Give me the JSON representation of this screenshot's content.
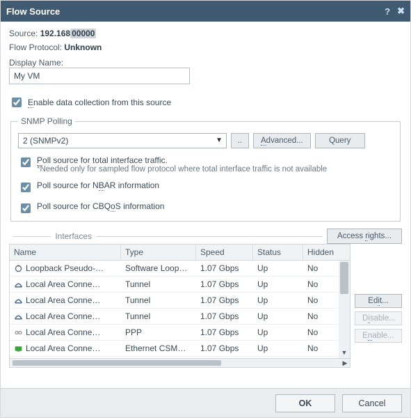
{
  "title": "Flow Source",
  "header": {
    "source_label": "Source:",
    "source_value": "192.168",
    "flow_protocol_label": "Flow Protocol:",
    "flow_protocol_value": "Unknown",
    "display_name_label": "Display Name:",
    "display_name_value": "My VM",
    "enable_label": "Enable data collection from this source"
  },
  "snmp": {
    "legend": "SNMP Polling",
    "version": "2 (SNMPv2)",
    "advanced_btn": "Advanced...",
    "query_btn": "Query",
    "poll_total_label": "Poll source for total interface traffic.",
    "poll_total_note": "*Needed only for sampled flow protocol where total interface traffic is not available",
    "poll_nbar_label": "Poll source for NBAR information",
    "poll_cbqos_label": "Poll source for CBQoS information"
  },
  "interfaces": {
    "title": "Interfaces",
    "access_btn": "Access rights...",
    "columns": {
      "name": "Name",
      "type": "Type",
      "speed": "Speed",
      "status": "Status",
      "hidden": "Hidden"
    },
    "rows": [
      {
        "icon": "loopback",
        "name": "Loopback Pseudo-…",
        "type": "Software Loop…",
        "speed": "1.07 Gbps",
        "status": "Up",
        "hidden": "No"
      },
      {
        "icon": "tunnel",
        "name": "Local Area Conne…",
        "type": "Tunnel",
        "speed": "1.07 Gbps",
        "status": "Up",
        "hidden": "No"
      },
      {
        "icon": "tunnel",
        "name": "Local Area Conne…",
        "type": "Tunnel",
        "speed": "1.07 Gbps",
        "status": "Up",
        "hidden": "No"
      },
      {
        "icon": "tunnel",
        "name": "Local Area Conne…",
        "type": "Tunnel",
        "speed": "1.07 Gbps",
        "status": "Up",
        "hidden": "No"
      },
      {
        "icon": "ppp",
        "name": "Local Area Conne…",
        "type": "PPP",
        "speed": "1.07 Gbps",
        "status": "Up",
        "hidden": "No"
      },
      {
        "icon": "ethernet",
        "name": "Local Area Conne…",
        "type": "Ethernet CSM…",
        "speed": "1.07 Gbps",
        "status": "Up",
        "hidden": "No"
      }
    ],
    "side": {
      "edit": "Edit...",
      "disable": "Disable...",
      "enable": "Enable..."
    }
  },
  "footer": {
    "ok": "OK",
    "cancel": "Cancel"
  }
}
